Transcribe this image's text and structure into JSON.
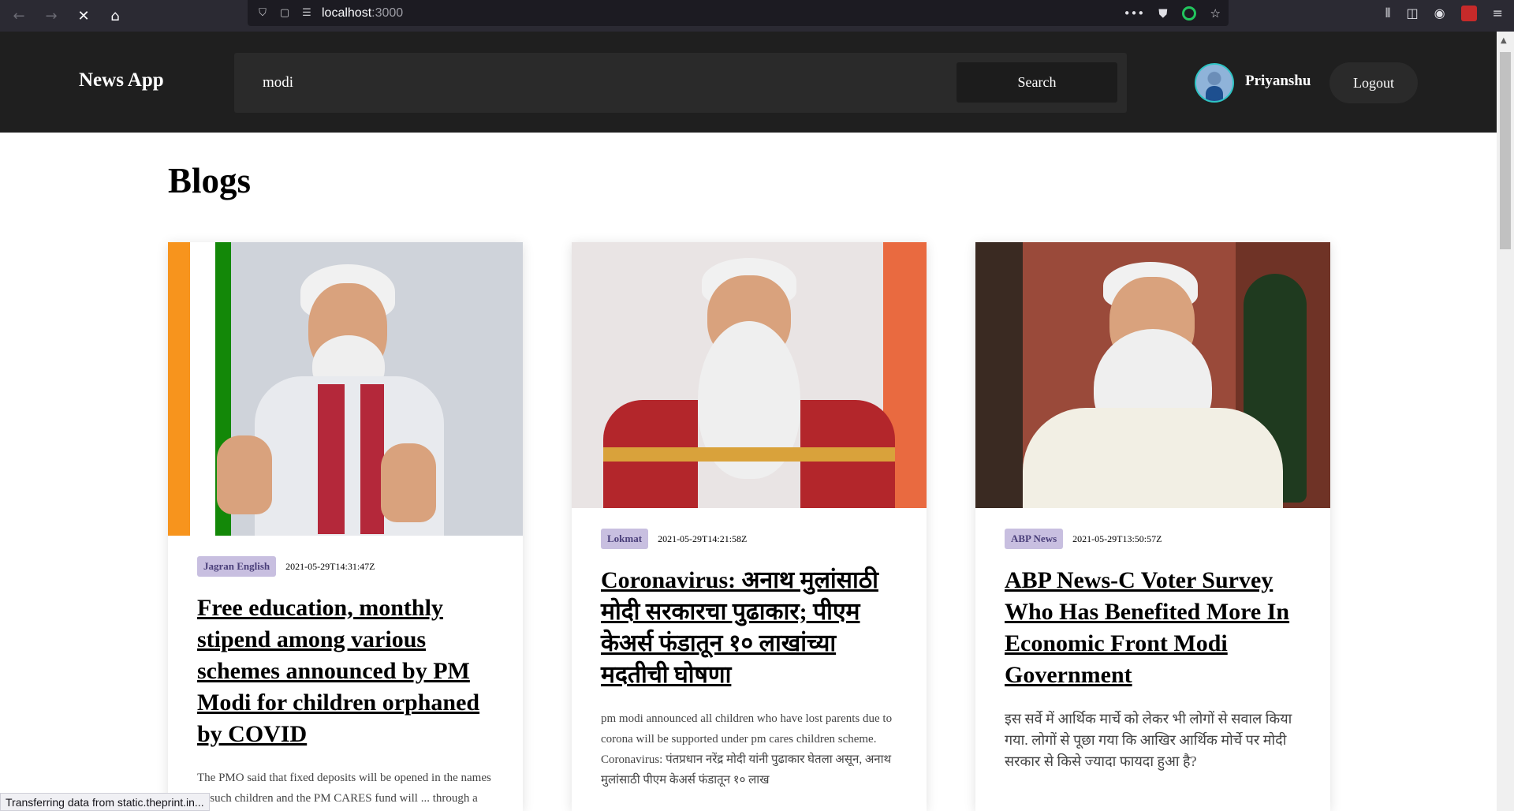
{
  "browser": {
    "url_host": "localhost",
    "url_port": ":3000",
    "status_text": "Transferring data from static.theprint.in..."
  },
  "header": {
    "brand": "News App",
    "search_value": "modi",
    "search_label": "Search",
    "username": "Priyanshu",
    "logout_label": "Logout"
  },
  "page": {
    "title": "Blogs"
  },
  "articles": [
    {
      "source": "Jagran English",
      "published": "2021-05-29T14:31:47Z",
      "title": "Free education, monthly stipend among various schemes announced by PM Modi for children orphaned by COVID",
      "description": "The PMO said that fixed deposits will be opened in the names of such children and the PM CARES fund will ... through a specially designed scheme to create ..."
    },
    {
      "source": "Lokmat",
      "published": "2021-05-29T14:21:58Z",
      "title": "Coronavirus: अनाथ मुलांसाठी मोदी सरकारचा पुढाकार; पीएम केअर्स फंडातून १० लाखांच्या मदतीची घोषणा",
      "description": "pm modi announced all children who have lost parents due to corona will be supported under pm cares children scheme. Coronavirus: पंतप्रधान नरेंद्र मोदी यांनी पुढाकार घेतला असून, अनाथ मुलांसाठी पीएम केअर्स फंडातून १० लाख"
    },
    {
      "source": "ABP News",
      "published": "2021-05-29T13:50:57Z",
      "title": "ABP News-C Voter Survey Who Has Benefited More In Economic Front Modi Government",
      "description": "इस सर्वे में आर्थिक मार्चे को लेकर भी लोगों से सवाल किया गया. लोगों से पूछा गया कि आखिर आर्थिक मोर्चे पर मोदी सरकार से किसे ज्यादा फायदा हुआ है?"
    }
  ]
}
